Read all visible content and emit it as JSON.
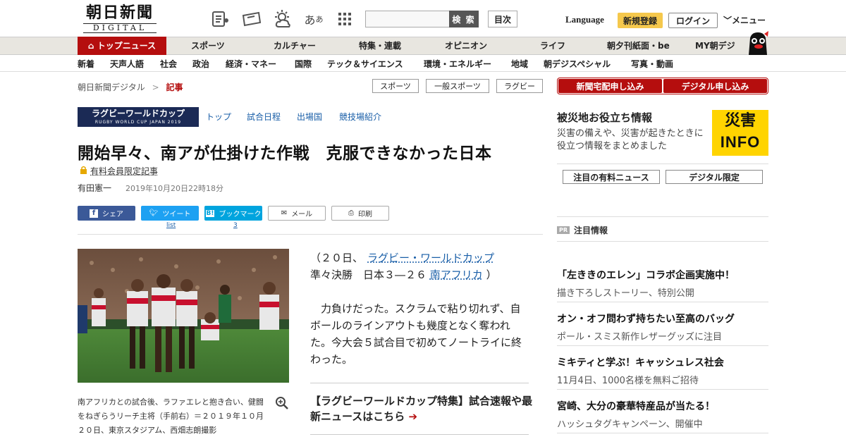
{
  "header": {
    "logo_main": "朝日新聞",
    "logo_sub": "DIGITAL",
    "search_button": "検 索",
    "toc_button": "目次",
    "language": "Language",
    "register": "新規登録",
    "login": "ログイン",
    "menu": "メニュー"
  },
  "nav_primary": [
    {
      "label": "トップニュース"
    },
    {
      "label": "スポーツ"
    },
    {
      "label": "カルチャー"
    },
    {
      "label": "特集・連載"
    },
    {
      "label": "オピニオン"
    },
    {
      "label": "ライフ"
    },
    {
      "label": "朝夕刊紙面・be"
    },
    {
      "label": "MY朝デジ"
    }
  ],
  "nav_secondary": [
    "新着",
    "天声人語",
    "社会",
    "政治",
    "経済・マネー",
    "国際",
    "テック＆サイエンス",
    "環境・エネルギー",
    "地域",
    "朝デジスペシャル",
    "写真・動画"
  ],
  "breadcrumb": {
    "home": "朝日新聞デジタル",
    "sep": ">",
    "current": "記事"
  },
  "tags": [
    "スポーツ",
    "一般スポーツ",
    "ラグビー"
  ],
  "rwc": {
    "logo_main": "ラグビーワールドカップ",
    "logo_sub": "RUGBY WORLD CUP JAPAN 2019",
    "links": [
      "トップ",
      "試合日程",
      "出場国",
      "競技場紹介"
    ]
  },
  "article": {
    "title": "開始早々、南アが仕掛けた作戦　克服できなかった日本",
    "paid_label": "有料会員限定記事",
    "author": "有田憲一",
    "date": "2019年10月20日22時18分",
    "share": {
      "facebook": "シェア",
      "twitter": "ツイート",
      "twitter_sub": "list",
      "hatena": "ブックマーク",
      "hatena_sub": "3",
      "mail": "メール",
      "print": "印刷"
    },
    "caption": "南アフリカとの試合後、ラファエレと抱き合い、健闘をねぎらうリーチ主将（手前右）＝２０１９年１０月２０日、東京スタジアム、西畑志朗撮影",
    "lead_prefix": "（２０日、",
    "lead_link1": "ラグビー・ワールドカップ",
    "lead_mid": "準々決勝　日本３―２６",
    "lead_link2": "南アフリカ",
    "lead_suffix": "）",
    "body": "　力負けだった。スクラムで粘り切れず、自ボールのラインアウトも幾度となく奪われた。今大会５試合目で初めてノートライに終わった。",
    "promo": "【ラグビーワールドカップ特集】試合速報や最新ニュースはこちら"
  },
  "sidebar": {
    "buttons": [
      "新聞宅配申し込み",
      "デジタル申し込み"
    ],
    "disaster_title": "被災地お役立ち情報",
    "disaster_desc": "災害の備えや、災害が起きたときに役立つ情報をまとめました",
    "disaster_badge_top": "災害",
    "disaster_badge_bottom": "INFO",
    "tabs": [
      "注目の有料ニュース",
      "デジタル限定"
    ],
    "pr_badge": "PR",
    "pr_label": "注目情報",
    "pr_items": [
      {
        "title": "「左ききのエレン」コラボ企画実施中！",
        "desc": "描き下ろしストーリー、特別公開"
      },
      {
        "title": "オン・オフ問わず持ちたい至高のバッグ",
        "desc": "ポール・スミス新作レザーグッズに注目"
      },
      {
        "title": "ミキティと学ぶ！キャッシュレス社会",
        "desc": "11月4日、1000名様を無料ご招待"
      },
      {
        "title": "宮崎、大分の豪華特産品が当たる！",
        "desc": "ハッシュタグキャンペーン、開催中"
      }
    ]
  },
  "colors": {
    "brand_red": "#b50e0e",
    "link_blue": "#1a5fa8",
    "register_yellow": "#f5c84c",
    "rwc_navy": "#1b2a55",
    "facebook": "#3b5998",
    "twitter": "#1da1f2",
    "hatena": "#00a4de"
  }
}
